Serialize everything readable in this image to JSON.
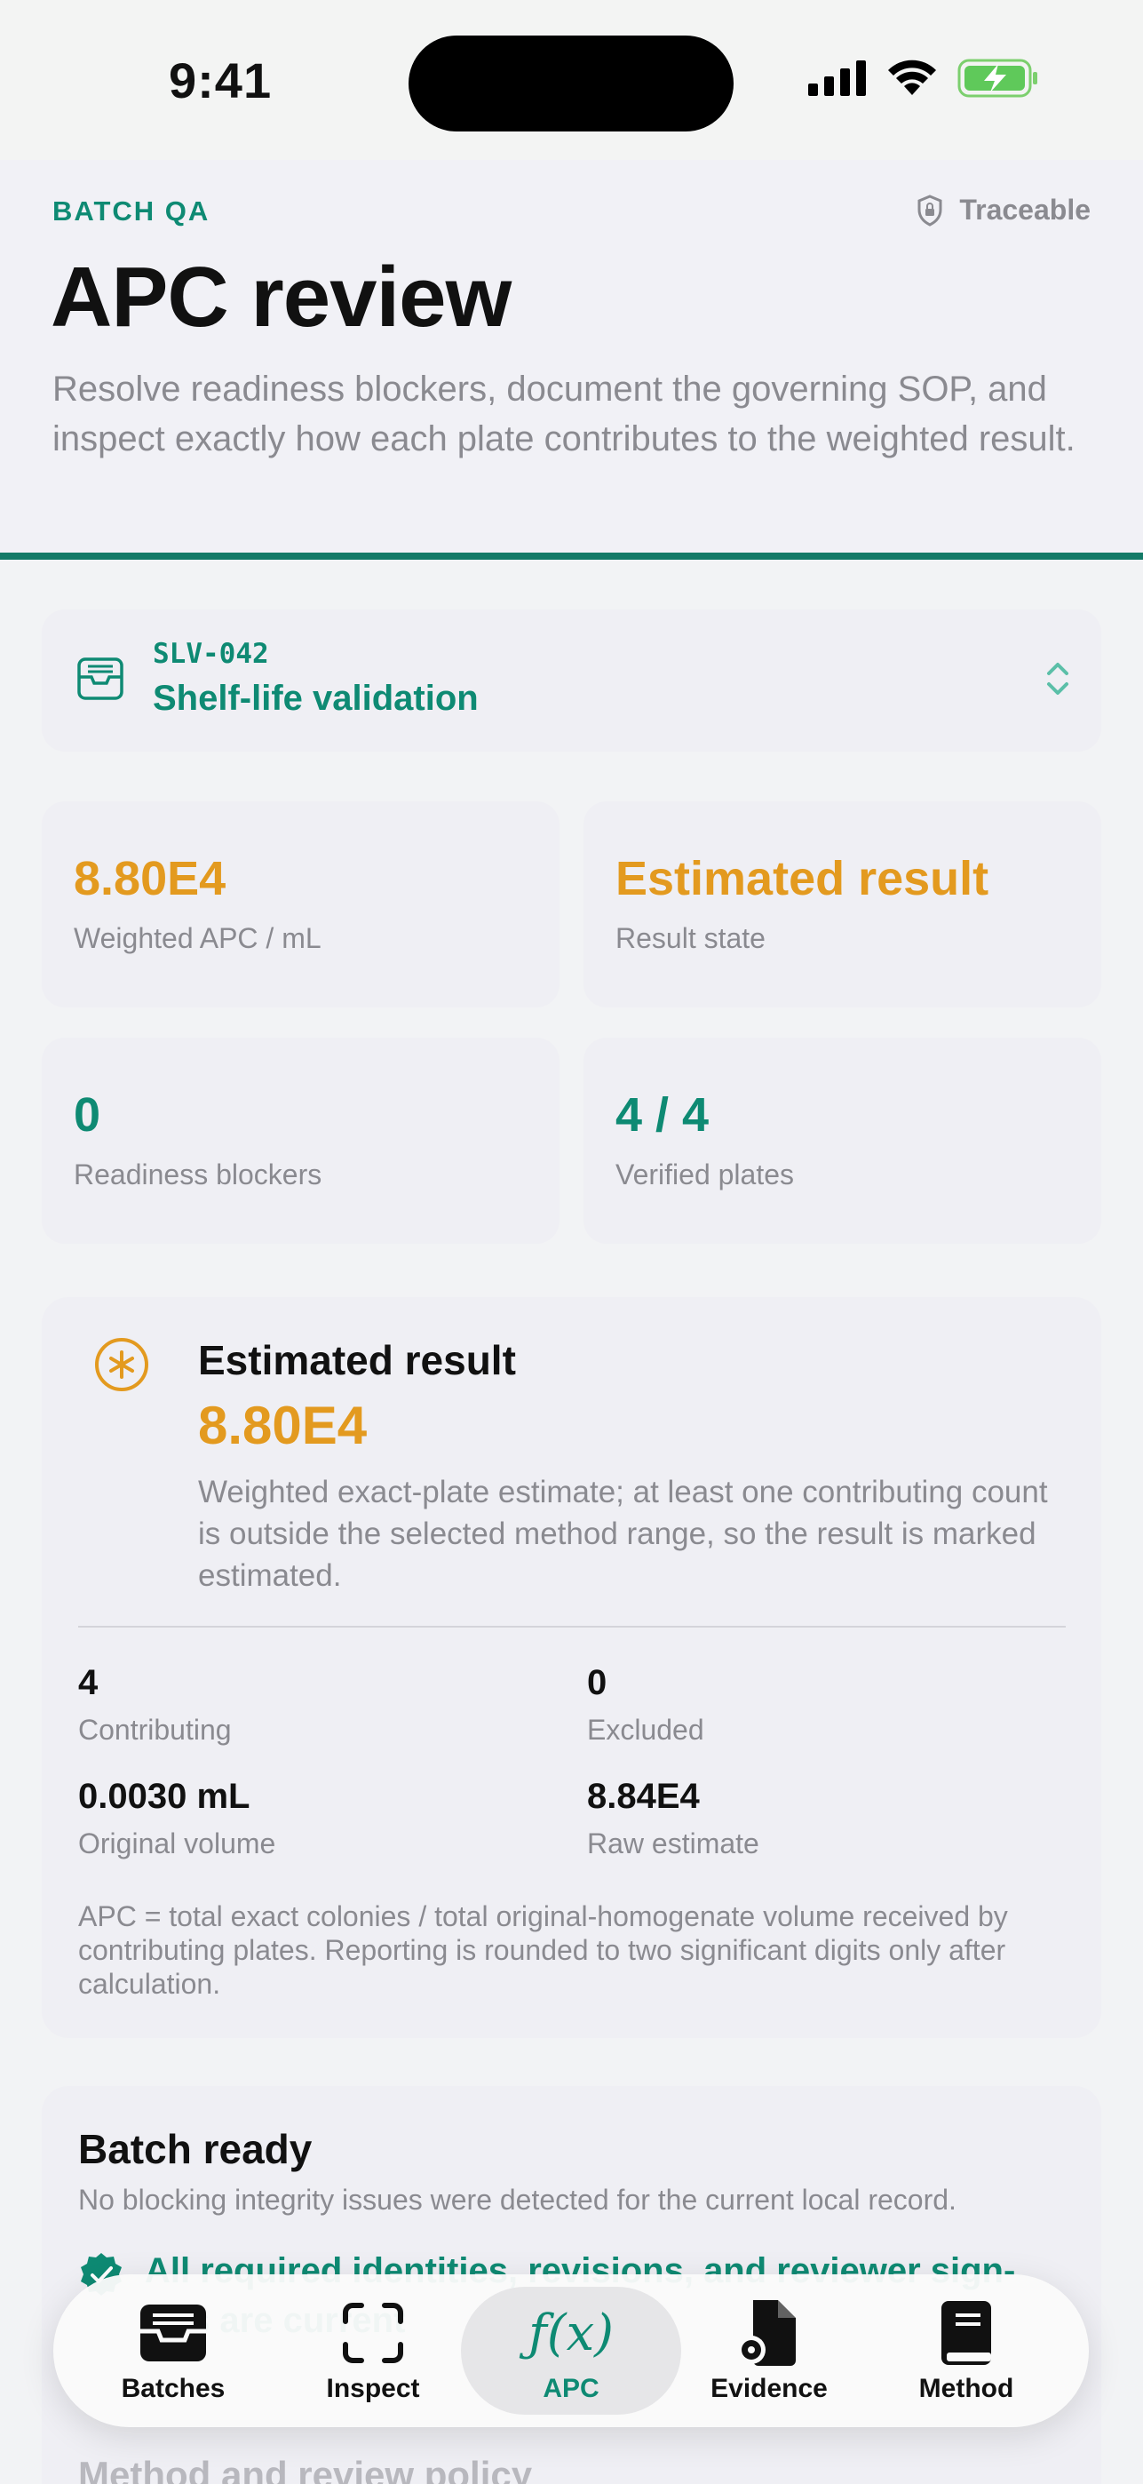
{
  "status_bar": {
    "time": "9:41"
  },
  "header": {
    "eyebrow": "BATCH QA",
    "badge": "Traceable",
    "title": "APC review",
    "subtitle": "Resolve readiness blockers, document the governing SOP, and inspect exactly how each plate contributes to the weighted result."
  },
  "batch_selector": {
    "code": "SLV-042",
    "name": "Shelf-life validation"
  },
  "stats": [
    {
      "value": "8.80E4",
      "label": "Weighted APC / mL",
      "tone": "orange"
    },
    {
      "value": "Estimated result",
      "label": "Result state",
      "tone": "orange"
    },
    {
      "value": "0",
      "label": "Readiness blockers",
      "tone": "green"
    },
    {
      "value": "4 / 4",
      "label": "Verified plates",
      "tone": "green"
    }
  ],
  "result": {
    "title": "Estimated result",
    "value": "8.80E4",
    "description": "Weighted exact-plate estimate; at least one contributing count is outside the selected method range, so the result is marked estimated.",
    "metrics": [
      {
        "value": "4",
        "label": "Contributing"
      },
      {
        "value": "0",
        "label": "Excluded"
      },
      {
        "value": "0.0030 mL",
        "label": "Original volume"
      },
      {
        "value": "8.84E4",
        "label": "Raw estimate"
      }
    ],
    "formula": "APC = total exact colonies / total original-homogenate volume received by contributing plates. Reporting is rounded to two significant digits only after calculation."
  },
  "readiness": {
    "title": "Batch ready",
    "subtitle": "No blocking integrity issues were detected for the current local record.",
    "check": "All required identities, revisions, and reviewer sign-offs are current"
  },
  "next_section": "Method and review policy",
  "tabs": [
    {
      "label": "Batches",
      "icon": "tray-icon"
    },
    {
      "label": "Inspect",
      "icon": "viewfinder-icon"
    },
    {
      "label": "APC",
      "icon": "function-icon",
      "glyph": "ƒ(x)",
      "active": true
    },
    {
      "label": "Evidence",
      "icon": "document-gear-icon"
    },
    {
      "label": "Method",
      "icon": "book-icon"
    }
  ],
  "colors": {
    "accent": "#0e8a73",
    "warning": "#e39a1f",
    "muted": "#8a8a90"
  }
}
